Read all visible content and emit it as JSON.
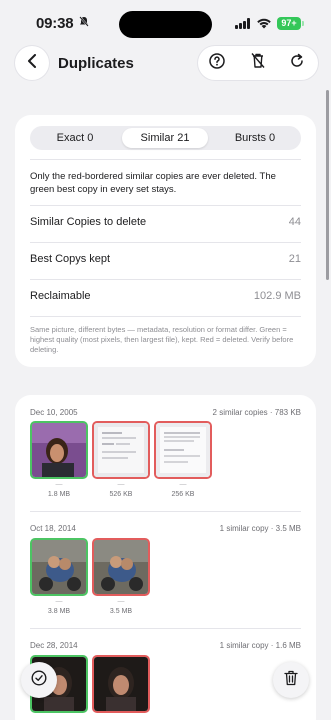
{
  "status_bar": {
    "time": "09:38",
    "battery": "97+"
  },
  "nav": {
    "title": "Duplicates",
    "icons": [
      "chevron-left-icon",
      "help-icon",
      "trash-disabled-icon",
      "refresh-icon"
    ]
  },
  "tabs": [
    {
      "label": "Exact 0",
      "active": false
    },
    {
      "label": "Similar 21",
      "active": true
    },
    {
      "label": "Bursts 0",
      "active": false
    }
  ],
  "summary": {
    "note": "Only the red-bordered similar copies are ever deleted. The green best copy in every set stays.",
    "rows": [
      {
        "label": "Similar Copies to delete",
        "value": "44"
      },
      {
        "label": "Best Copys kept",
        "value": "21"
      },
      {
        "label": "Reclaimable",
        "value": "102.9 MB"
      }
    ],
    "fine_print": "Same picture, different bytes — metadata, resolution or format differ. Green = highest quality (most pixels, then largest file), kept. Red = deleted. Verify before deleting."
  },
  "groups": [
    {
      "date": "Dec 10, 2005",
      "info": "2 similar copies · 783 KB",
      "photos": [
        {
          "size": "1.8 MB",
          "status": "best"
        },
        {
          "size": "526 KB",
          "status": "delete"
        },
        {
          "size": "256 KB",
          "status": "delete"
        }
      ]
    },
    {
      "date": "Oct 18, 2014",
      "info": "1 similar copy · 3.5 MB",
      "photos": [
        {
          "size": "3.8 MB",
          "status": "best"
        },
        {
          "size": "3.5 MB",
          "status": "delete"
        }
      ]
    },
    {
      "date": "Dec 28, 2014",
      "info": "1 similar copy · 1.6 MB",
      "photos": [
        {
          "size": "",
          "status": "best"
        },
        {
          "size": "",
          "status": "delete"
        }
      ]
    }
  ],
  "colors": {
    "best": "#4cc463",
    "delete": "#e25c5c",
    "battery": "#34c759"
  }
}
